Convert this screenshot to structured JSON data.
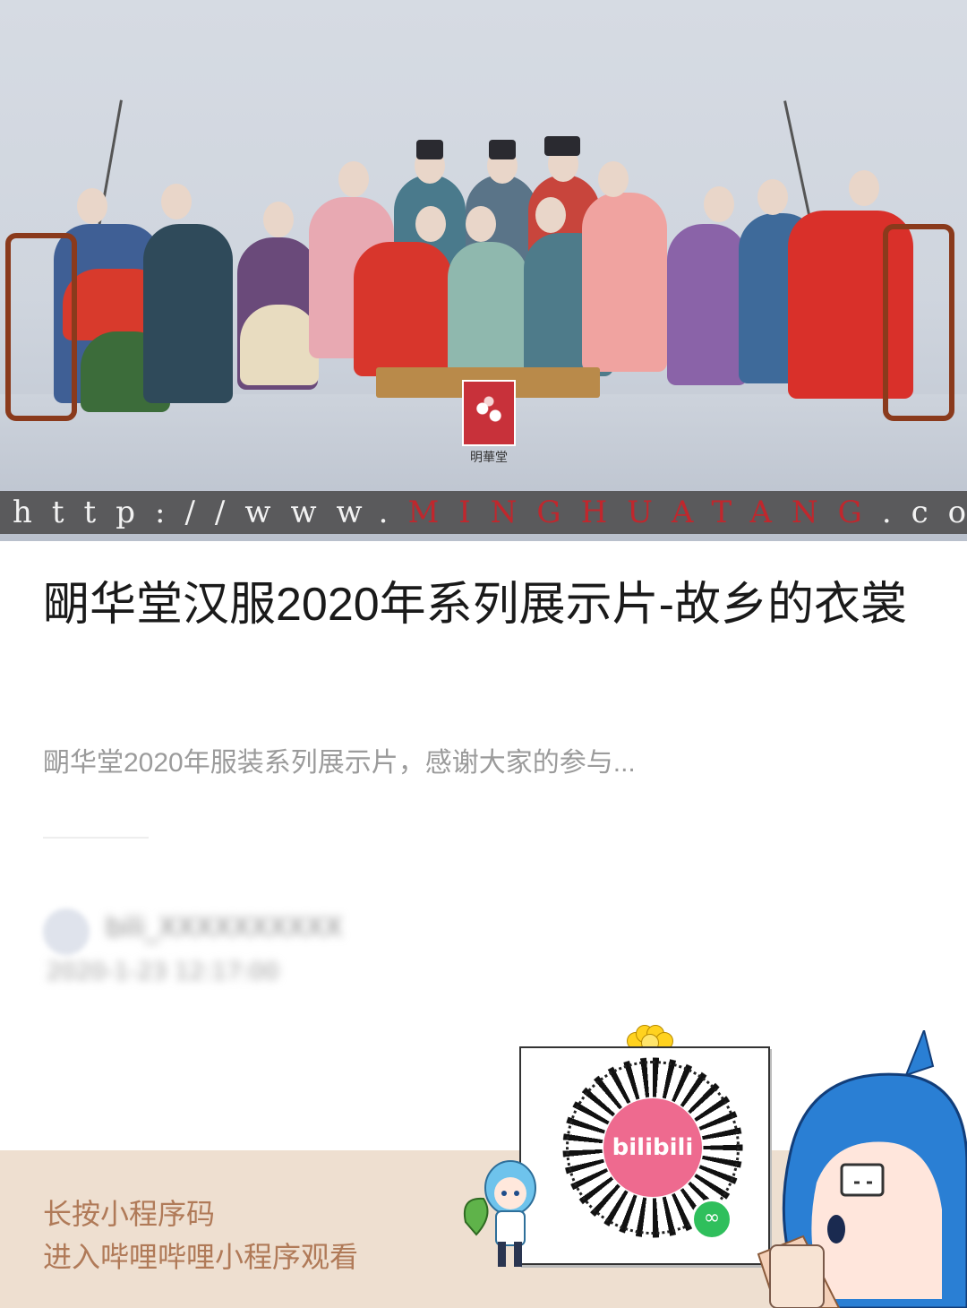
{
  "hero": {
    "url_prefix": "http://www.",
    "url_brand": "MINGHUATANG",
    "url_suffix": ".com",
    "logo_caption": "明華堂"
  },
  "article": {
    "title": "朙华堂汉服2020年系列展示片-故乡的衣裳",
    "description": "朙华堂2020年服装系列展示片，感谢大家的参与..."
  },
  "author": {
    "username_blurred": "bili_XXXXXXXXXX",
    "date_blurred": "2020-1-23 12:17:00"
  },
  "footer": {
    "line1": "长按小程序码",
    "line2": "进入哔哩哔哩小程序观看"
  },
  "qr": {
    "center_label": "bilibili"
  },
  "colors": {
    "footer_bg": "#eedfd0",
    "footer_text": "#b07a58",
    "url_brand": "#c0272d",
    "bili_pink": "#ee6a8f"
  }
}
